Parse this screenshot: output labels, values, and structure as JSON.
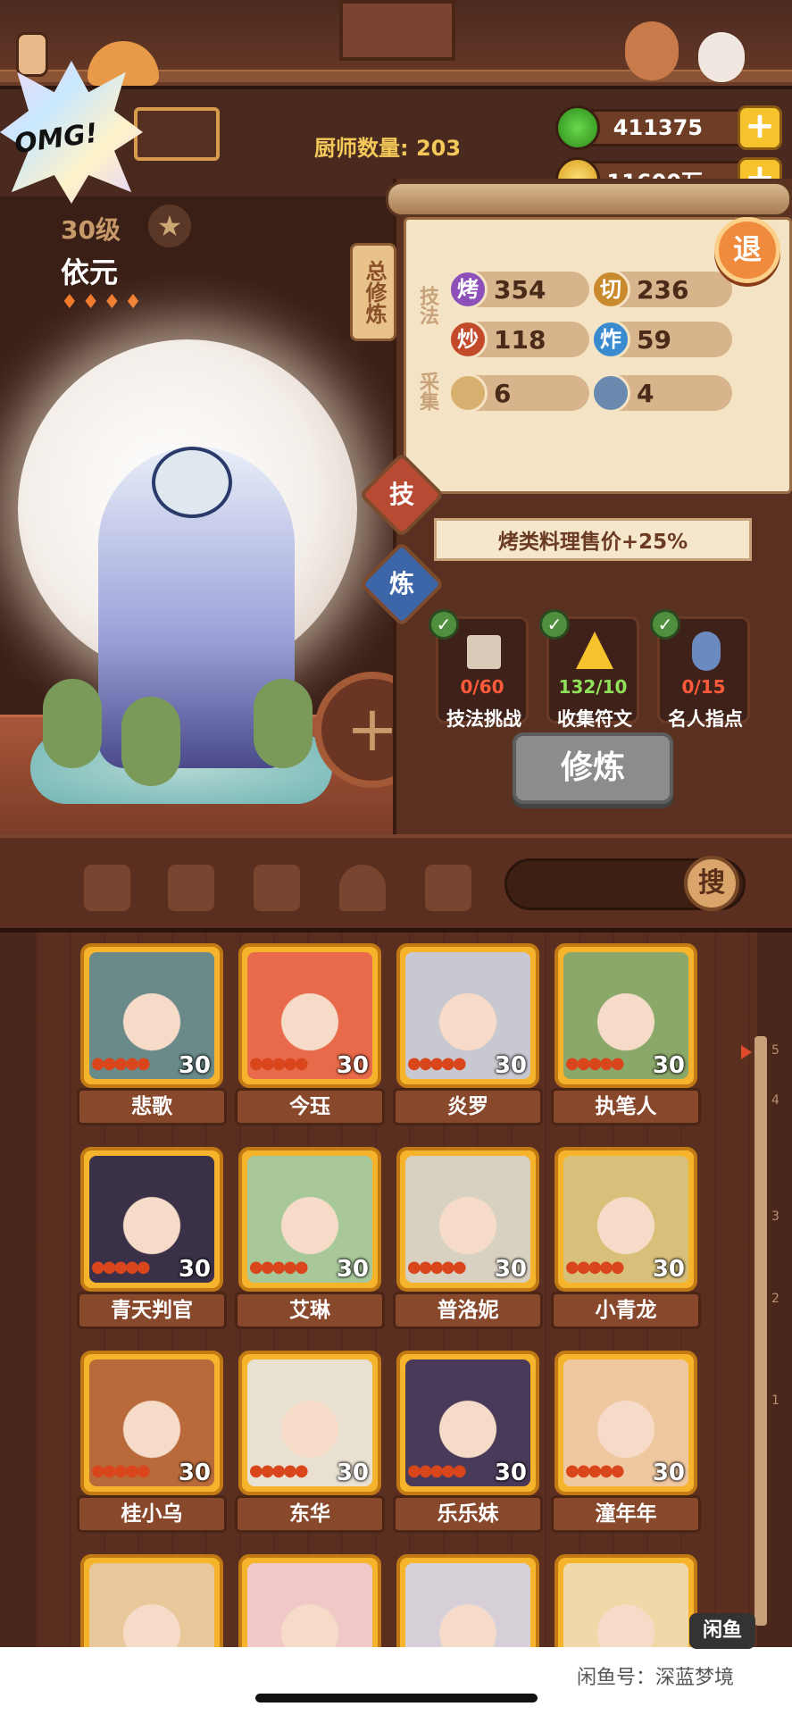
{
  "header": {
    "chef_count_label": "厨师数量: 203",
    "currency1": "411375",
    "currency2": "11600万",
    "plus": "+",
    "omg": "OMG!"
  },
  "profile": {
    "level": "30级",
    "name": "依元",
    "star": "★"
  },
  "panel": {
    "tab_total": "总修炼",
    "section_skill": "技法",
    "section_gather": "采集",
    "stats": [
      {
        "icon": "烤",
        "value": "354",
        "color": "#8d4fb8"
      },
      {
        "icon": "切",
        "value": "236",
        "color": "#c88a2c"
      },
      {
        "icon": "炒",
        "value": "118",
        "color": "#c24a2a"
      },
      {
        "icon": "炸",
        "value": "59",
        "color": "#3a8ad0"
      },
      {
        "icon": "",
        "value": "6",
        "color": "#d8b070"
      },
      {
        "icon": "",
        "value": "4",
        "color": "#6a8ab0"
      }
    ],
    "exit_btn": "退",
    "btn_skill": "技",
    "btn_train": "炼",
    "bonus": "烤类料理售价+25%",
    "tasks": [
      {
        "label": "技法挑战",
        "count": "0/60",
        "count_color": "#ff5a3a"
      },
      {
        "label": "收集符文",
        "count": "132/10",
        "count_color": "#8fe05a"
      },
      {
        "label": "名人指点",
        "count": "0/15",
        "count_color": "#ff5a3a"
      }
    ],
    "train_button": "修炼",
    "big_plus": "+"
  },
  "filters": {
    "icons": [
      "shovel-icon",
      "spade-icon",
      "jar-icon",
      "map-pin-icon",
      "map-question-icon"
    ],
    "search_btn": "搜"
  },
  "chefs": [
    {
      "name": "悲歌",
      "level": "30",
      "color": "#6a8a8a"
    },
    {
      "name": "今珏",
      "level": "30",
      "color": "#e86a4a"
    },
    {
      "name": "炎罗",
      "level": "30",
      "color": "#c8c8d0"
    },
    {
      "name": "执笔人",
      "level": "30",
      "color": "#8aa86a"
    },
    {
      "name": "青天判官",
      "level": "30",
      "color": "#3a3048"
    },
    {
      "name": "艾琳",
      "level": "30",
      "color": "#a8c89a"
    },
    {
      "name": "普洛妮",
      "level": "30",
      "color": "#d8d0c0"
    },
    {
      "name": "小青龙",
      "level": "30",
      "color": "#d8c07a"
    },
    {
      "name": "桂小乌",
      "level": "30",
      "color": "#b86a3a"
    },
    {
      "name": "东华",
      "level": "30",
      "color": "#e8e0d0"
    },
    {
      "name": "乐乐妹",
      "level": "30",
      "color": "#4a3a5a"
    },
    {
      "name": "潼年年",
      "level": "30",
      "color": "#f0c8a0"
    },
    {
      "name": "",
      "level": "",
      "color": "#e8c89a"
    },
    {
      "name": "",
      "level": "",
      "color": "#f0c8c8"
    },
    {
      "name": "",
      "level": "",
      "color": "#d8d0d8"
    },
    {
      "name": "",
      "level": "",
      "color": "#f0d8a8"
    }
  ],
  "flames": "♠♠♠♠♠",
  "ruler_ticks": [
    "5",
    "4",
    "3",
    "2",
    "1"
  ],
  "watermark": {
    "logo": "闲鱼",
    "text": "闲鱼号：深蓝梦境"
  }
}
